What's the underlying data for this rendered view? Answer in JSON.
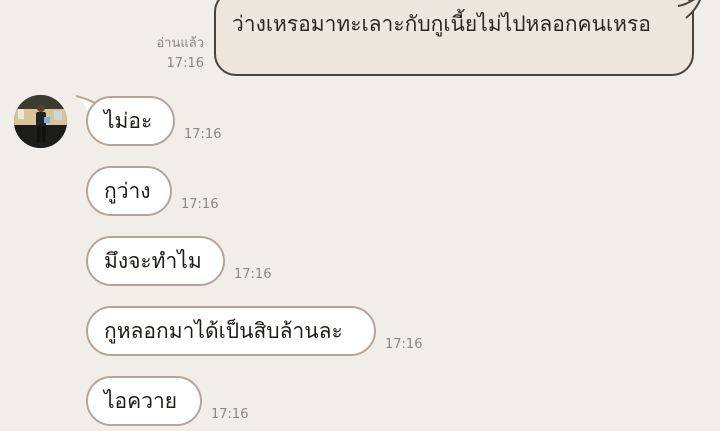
{
  "outgoing": {
    "text": "ว่างเหรอมาทะเลาะกับกูเนี้ยไม่ไปหลอกคนเหรอ",
    "read_status": "อ่านแล้ว",
    "time": "17:16"
  },
  "incoming": [
    {
      "text": "ไม่อะ",
      "time": "17:16"
    },
    {
      "text": "กูว่าง",
      "time": "17:16"
    },
    {
      "text": "มึงจะทำไม",
      "time": "17:16"
    },
    {
      "text": "กูหลอกมาได้เป็นสิบล้านละ",
      "time": "17:16"
    },
    {
      "text": "ไอควาย",
      "time": "17:16"
    }
  ],
  "colors": {
    "background": "#f1ede8",
    "outgoing_bubble": "#ede6df",
    "outgoing_border": "#4a4440",
    "incoming_bubble": "#ffffff",
    "incoming_border": "#b6a497",
    "meta_text": "#8f8780"
  }
}
